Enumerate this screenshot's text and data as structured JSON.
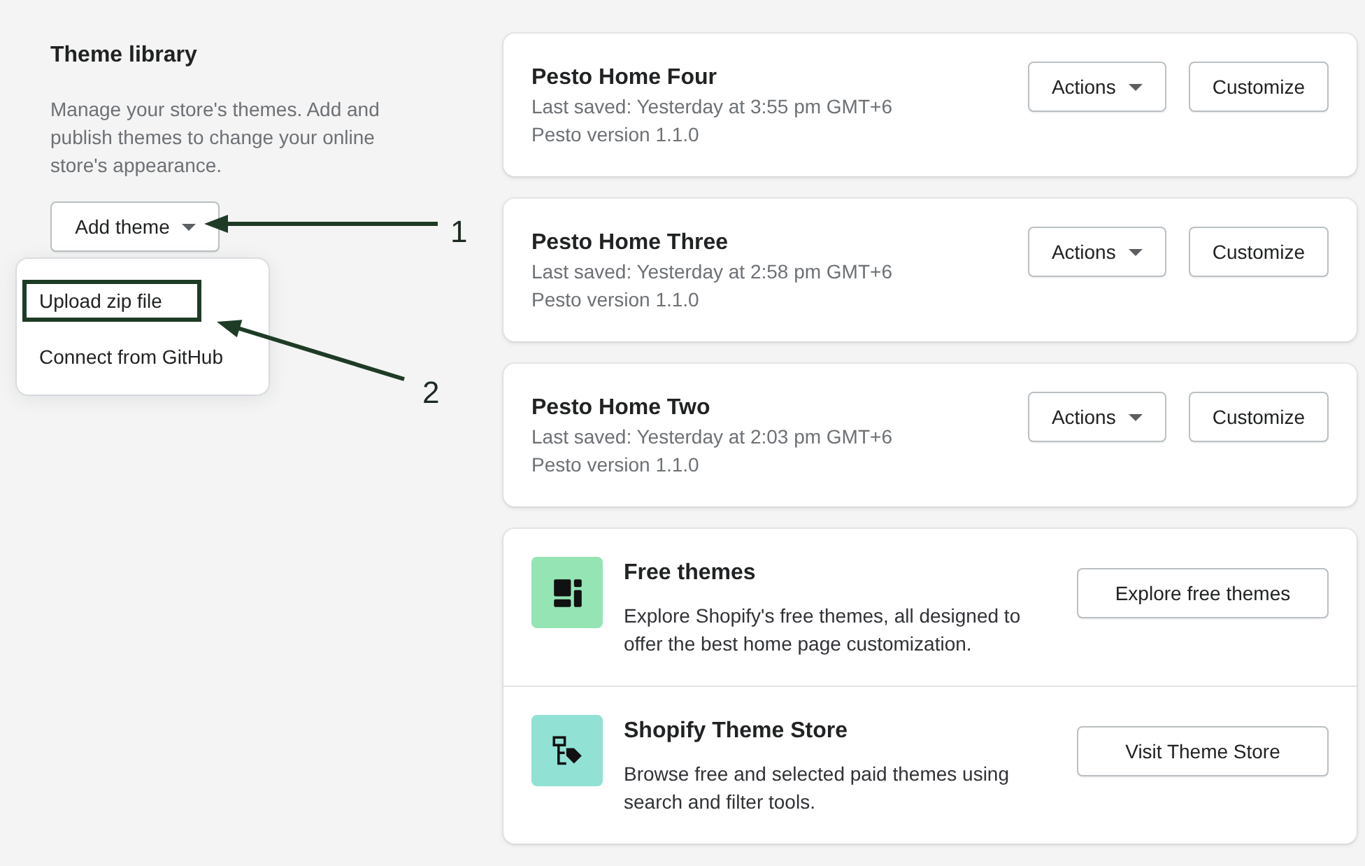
{
  "sidebar": {
    "title": "Theme library",
    "description": "Manage your store's themes. Add and publish themes to change your online store's appearance.",
    "add_button": {
      "label": "Add theme",
      "expanded": true
    },
    "menu": {
      "items": [
        {
          "label": "Upload zip file",
          "highlighted": true
        },
        {
          "label": "Connect from GitHub",
          "highlighted": false
        }
      ]
    }
  },
  "themes": [
    {
      "name": "Pesto Home Four",
      "last_saved": "Last saved: Yesterday at 3:55 pm GMT+6",
      "version": "Pesto version 1.1.0",
      "actions_label": "Actions",
      "customize_label": "Customize"
    },
    {
      "name": "Pesto Home Three",
      "last_saved": "Last saved: Yesterday at 2:58 pm GMT+6",
      "version": "Pesto version 1.1.0",
      "actions_label": "Actions",
      "customize_label": "Customize"
    },
    {
      "name": "Pesto Home Two",
      "last_saved": "Last saved: Yesterday at 2:03 pm GMT+6",
      "version": "Pesto version 1.1.0",
      "actions_label": "Actions",
      "customize_label": "Customize"
    }
  ],
  "discover": [
    {
      "kind": "layout",
      "color": "#95e4b4",
      "title": "Free themes",
      "description": "Explore Shopify's free themes, all designed to offer the best home page customization.",
      "button": "Explore free themes"
    },
    {
      "kind": "store",
      "color": "#92e1d5",
      "title": "Shopify Theme Store",
      "description": "Browse free and selected paid themes using search and filter tools.",
      "button": "Visit Theme Store"
    }
  ],
  "annotations": [
    {
      "label": "1"
    },
    {
      "label": "2"
    }
  ]
}
